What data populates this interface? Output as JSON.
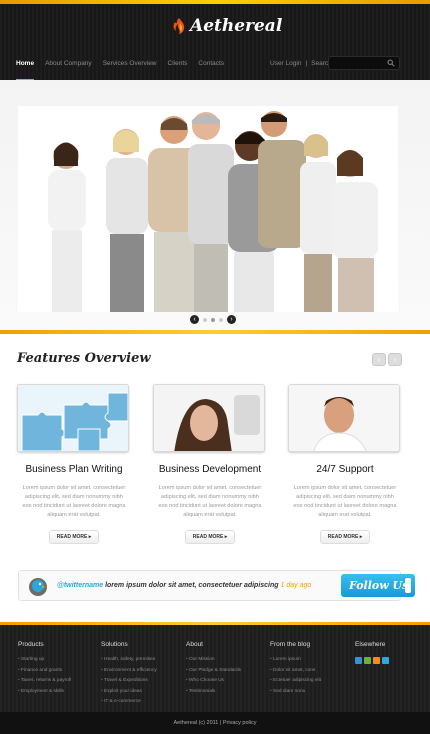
{
  "brand": {
    "name": "Aethereal"
  },
  "nav": {
    "items": [
      "Home",
      "About Company",
      "Services Overview",
      "Clients",
      "Contacts"
    ],
    "user_login": "User Login",
    "separator": "|",
    "search_label": "Search",
    "search_placeholder": ""
  },
  "slider": {
    "active_index": 1,
    "dots": 3,
    "prev": "‹",
    "next": "›"
  },
  "features": {
    "title": "Features Overview",
    "prev": "‹",
    "next": "›",
    "columns": [
      {
        "heading": "Business Plan Writing",
        "text": "Lorem ipsum dolor sit amet, consectetuer adipiscing elit, sed diam nonummy nibh eos nod tincidunt ut laoreet dolore magna aliquam erat volutpat.",
        "button": "READ MORE"
      },
      {
        "heading": "Business Development",
        "text": "Lorem ipsum dolor sit amet, consectetuer adipiscing elit, sed diam nonummy nibh eos nod tincidunt ut laoreet dolore magna aliquam erat volutpat.",
        "button": "READ MORE"
      },
      {
        "heading": "24/7 Support",
        "text": "Lorem ipsum dolor sit amet, consectetuer adipiscing elit, sed diam nonummy nibh eos nod tincidunt ut laoreet dolore magna aliquam erat volutpat.",
        "button": "READ MORE"
      }
    ]
  },
  "twitter": {
    "handle": "@twittername",
    "message": " lorem ipsum dolor sit amet, consectetuer adipiscing",
    "ago": " 1 day ago",
    "follow": "Follow Us"
  },
  "footer": {
    "columns": [
      {
        "title": "Products",
        "items": [
          "Starting up",
          "Finance and grants",
          "Taxes, returns & payroll",
          "Employment & skills"
        ]
      },
      {
        "title": "Solutions",
        "items": [
          "Health, safety, premises",
          "Environment & efficiency",
          "Travel & Expeditions",
          "Exploit your ideas",
          "IT & e-commerce"
        ]
      },
      {
        "title": "About",
        "items": [
          "Our Mission",
          "Our Pledge & Standards",
          "Who Choose Us",
          "Testimonials"
        ]
      },
      {
        "title": "From the blog",
        "items": [
          "Lorem ipsum",
          "Dolor sit amet, cons",
          "Ectetuer adipiscing elit",
          "Sed diam nonu"
        ]
      },
      {
        "title": "Elsewhere",
        "items": []
      }
    ],
    "social_colors": [
      "#3b8fd6",
      "#6bb13e",
      "#f58a1f",
      "#29a9e0"
    ],
    "copyright": "Aethereal (c) 2011",
    "separator": "|",
    "privacy": "Privacy policy"
  },
  "colors": {
    "accent": "#f59c00",
    "twitter_blue": "#2ba7dd",
    "dark": "#1d1d1d"
  }
}
